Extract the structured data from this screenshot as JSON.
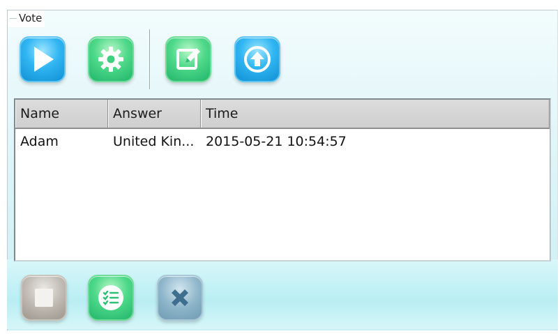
{
  "group": {
    "title": "Vote"
  },
  "toolbar": [
    {
      "name": "play-button",
      "icon": "play-icon"
    },
    {
      "name": "settings-button",
      "icon": "gear-icon"
    },
    {
      "name": "edit-button",
      "icon": "edit-icon"
    },
    {
      "name": "upload-button",
      "icon": "arrow-up-icon"
    }
  ],
  "table": {
    "columns": [
      "Name",
      "Answer",
      "Time"
    ],
    "rows": [
      [
        "Adam",
        "United Kin...",
        "2015-05-21 10:54:57"
      ]
    ]
  },
  "bottom_toolbar": [
    {
      "name": "stop-button",
      "icon": "stop-icon"
    },
    {
      "name": "results-button",
      "icon": "checklist-icon"
    },
    {
      "name": "clear-button",
      "icon": "close-icon"
    }
  ]
}
